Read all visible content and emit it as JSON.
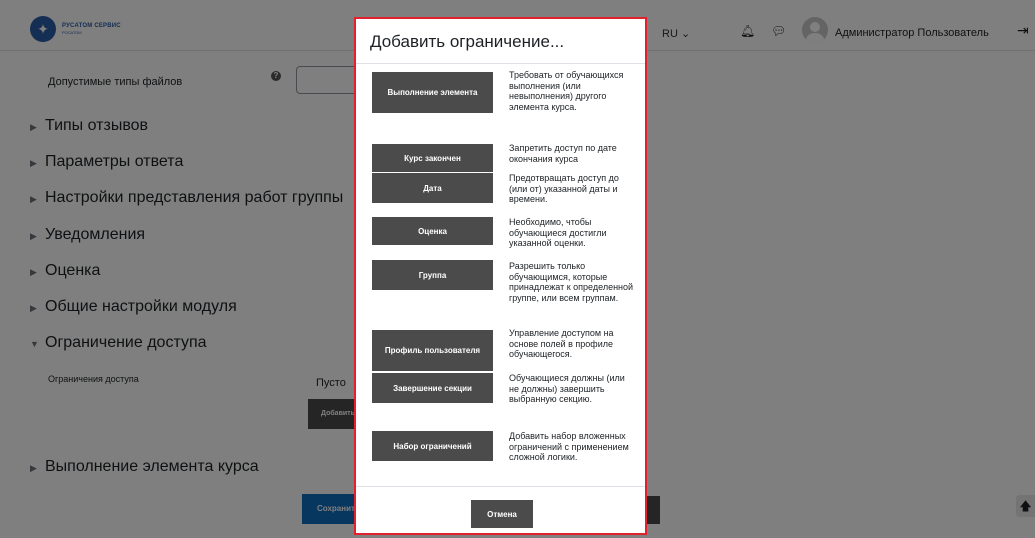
{
  "header": {
    "logo_title": "РУСАТОМ СЕРВИС",
    "logo_subtitle": "РОСАТОМ",
    "language": "RU ⌄",
    "user_name": "Администратор Пользователь"
  },
  "form": {
    "file_types_label": "Допустимые типы файлов",
    "sections": [
      "Типы отзывов",
      "Параметры ответа",
      "Настройки представления работ группы",
      "Уведомления",
      "Оценка",
      "Общие настройки модуля",
      "Ограничение доступа",
      "Выполнение элемента курса"
    ],
    "restrict_label": "Ограничения доступа",
    "restrict_empty": "Пусто",
    "add_restriction_label": "Добавить ограничение...",
    "save_label": "Сохранить и вернуться к курсу"
  },
  "dialog": {
    "title": "Добавить ограничение...",
    "options": [
      {
        "label": "Выполнение элемента",
        "description": "Требовать от обучающихся выполнения (или невыполнения) другого элемента курса."
      },
      {
        "label": "Курс закончен",
        "description": "Запретить доступ по дате окончания курса"
      },
      {
        "label": "Дата",
        "description": "Предотвращать доступ до (или от) указанной даты и времени."
      },
      {
        "label": "Оценка",
        "description": "Необходимо, чтобы обучающиеся достигли указанной оценки."
      },
      {
        "label": "Группа",
        "description": "Разрешить только обучающимся, которые принадлежат к определенной группе, или всем группам."
      },
      {
        "label": "Профиль пользователя",
        "description": "Управление доступом на основе полей в профиле обучающегося."
      },
      {
        "label": "Завершение секции",
        "description": "Обучающиеся должны (или не должны) завершить выбранную секцию."
      },
      {
        "label": "Набор ограничений",
        "description": "Добавить набор вложенных ограничений с применением сложной логики."
      }
    ],
    "cancel_label": "Отмена"
  },
  "icons": {
    "help": "question-circle-icon",
    "bell": "bell-icon",
    "chat": "chat-bubble-icon",
    "logout": "logout-icon",
    "scroll_top": "arrow-up-icon"
  },
  "colors": {
    "primary": "#0f6cbf",
    "dark_button": "#4b4b4b",
    "highlight_border": "#e5202e"
  }
}
